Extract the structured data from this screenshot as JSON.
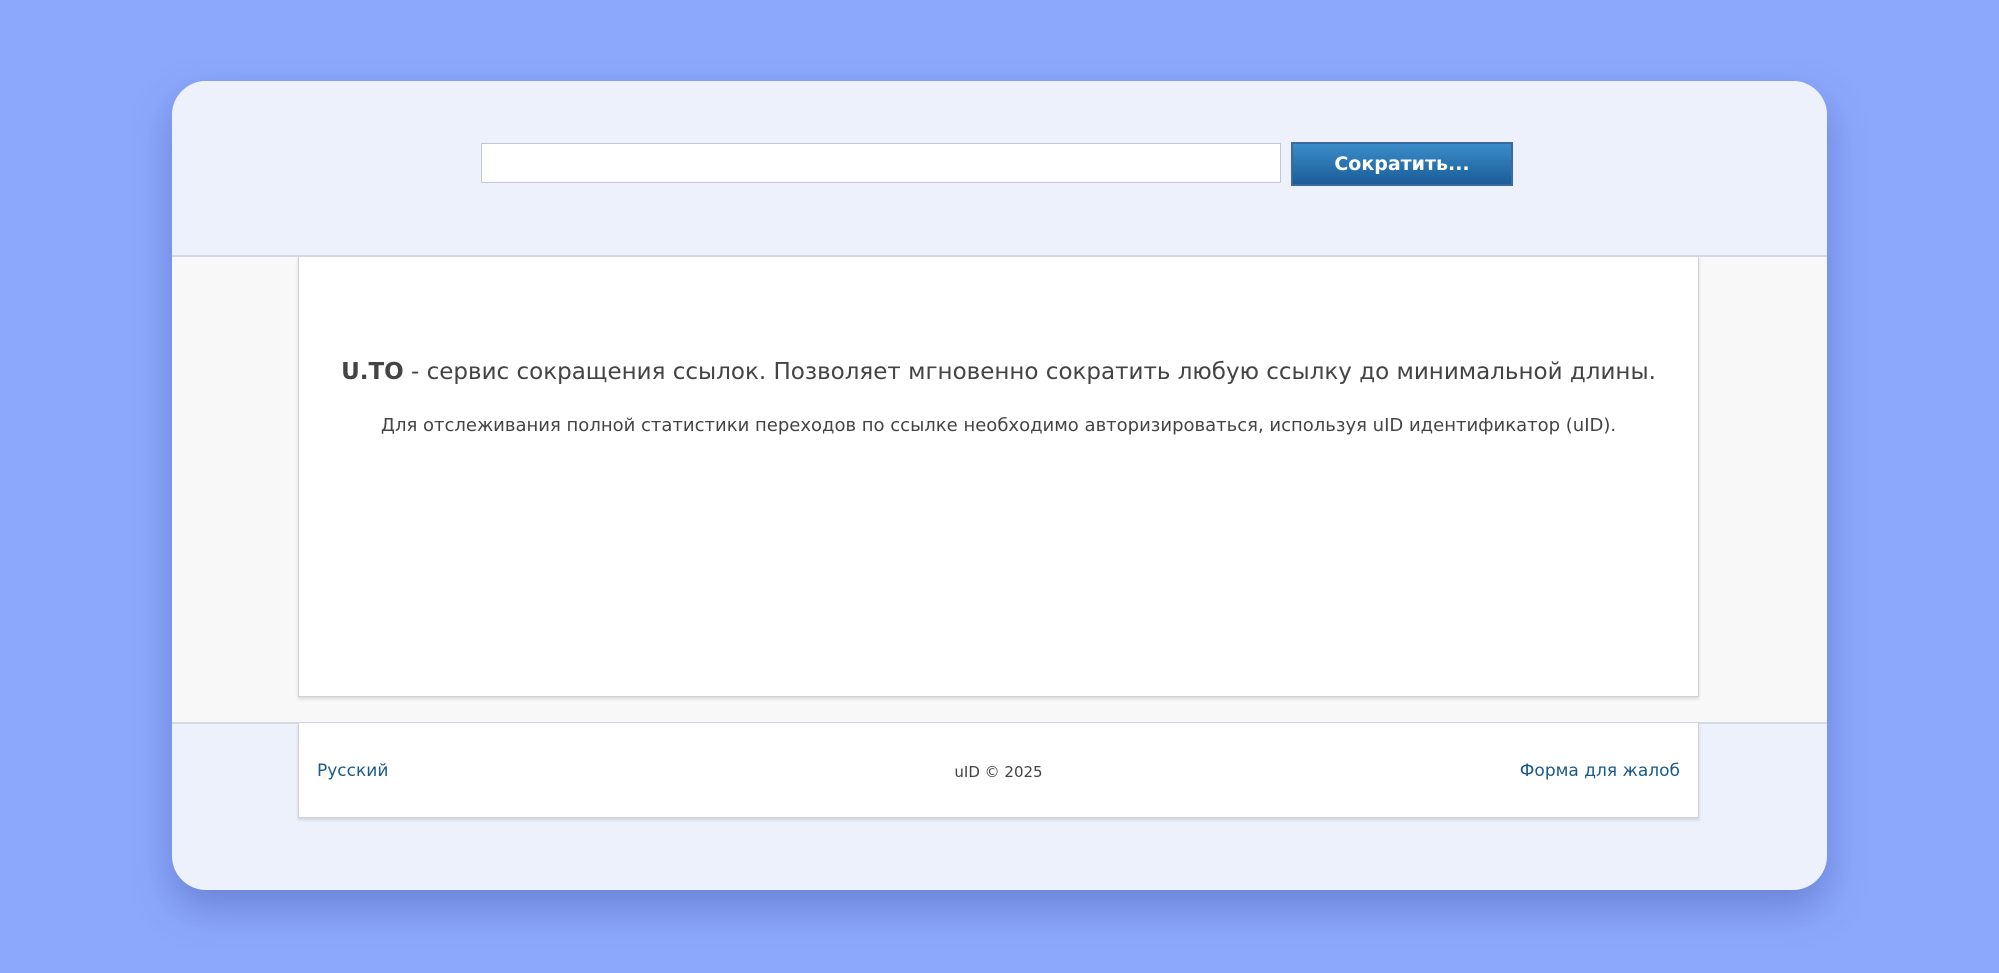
{
  "search": {
    "value": "",
    "placeholder": "",
    "button_label": "Сократить..."
  },
  "main": {
    "brand": "U.TO",
    "headline_rest": " - сервис сокращения ссылок. Позволяет мгновенно сократить любую ссылку до минимальной длины.",
    "subline": "Для отслеживания полной статистики переходов по ссылке необходимо авторизироваться, используя uID идентификатор (uID)."
  },
  "footer": {
    "language": "Русский",
    "copyright": "uID © 2025",
    "complaint_link": "Форма для жалоб"
  },
  "colors": {
    "page_background": "#8ca8fd",
    "panel_background": "#edf1fb",
    "button_top": "#3a8cc8",
    "button_bottom": "#1b5d99",
    "link": "#1a5a8a"
  }
}
